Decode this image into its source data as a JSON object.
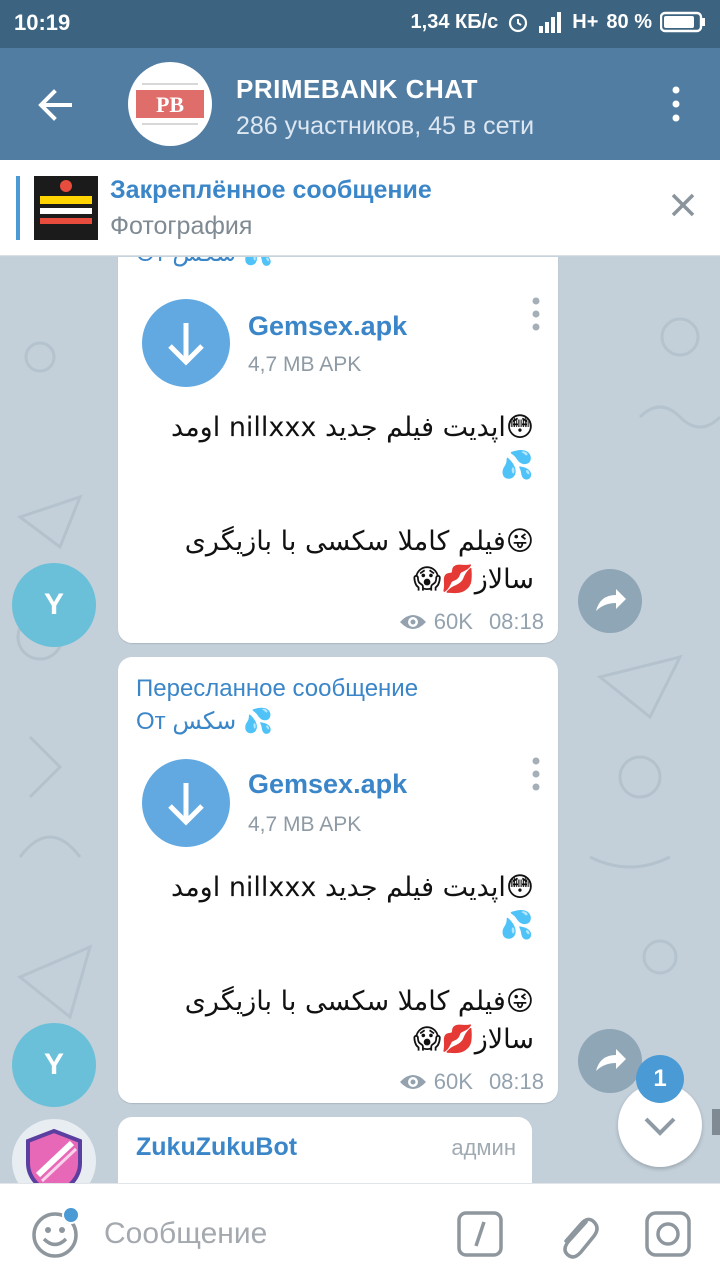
{
  "status_bar": {
    "time": "10:19",
    "speed": "1,34 КБ/с",
    "network": "H+",
    "battery": "80 %"
  },
  "header": {
    "title": "PRIMEBANK CHAT",
    "subtitle": "286 участников, 45 в сети",
    "avatar_text": "PB"
  },
  "pinned": {
    "title": "Закреплённое сообщение",
    "subtitle": "Фотография"
  },
  "messages": [
    {
      "forward_from": "От سکس 💦",
      "file_name": "Gemsex.apk",
      "file_meta": "4,7 MB APK",
      "text_line1": "😳اپدیت فیلم جدید nillxxx اومد",
      "text_line2": "💦",
      "text_line3": "😜فیلم کاملا سکسی با بازیگری",
      "text_line4": "سالاز💋😱",
      "views": "60K",
      "time": "08:18",
      "avatar_letter": "Y"
    },
    {
      "forward_label": "Пересланное сообщение",
      "forward_from": "От سکس 💦",
      "file_name": "Gemsex.apk",
      "file_meta": "4,7 MB APK",
      "text_line1": "😳اپدیت فیلم جدید nillxxx اومد",
      "text_line2": "💦",
      "text_line3": "😜فیلم کاملا سکسی با بازیگری",
      "text_line4": "سالاز💋😱",
      "views": "60K",
      "time": "08:18",
      "avatar_letter": "Y"
    }
  ],
  "bot_message": {
    "name": "ZukuZukuBot",
    "role": "админ"
  },
  "scroll_badge": "1",
  "input": {
    "placeholder": "Сообщение"
  },
  "colors": {
    "header": "#527da3",
    "status_bar": "#3c6380",
    "accent": "#3a86c8",
    "avatar_y": "#6ac0d8"
  }
}
